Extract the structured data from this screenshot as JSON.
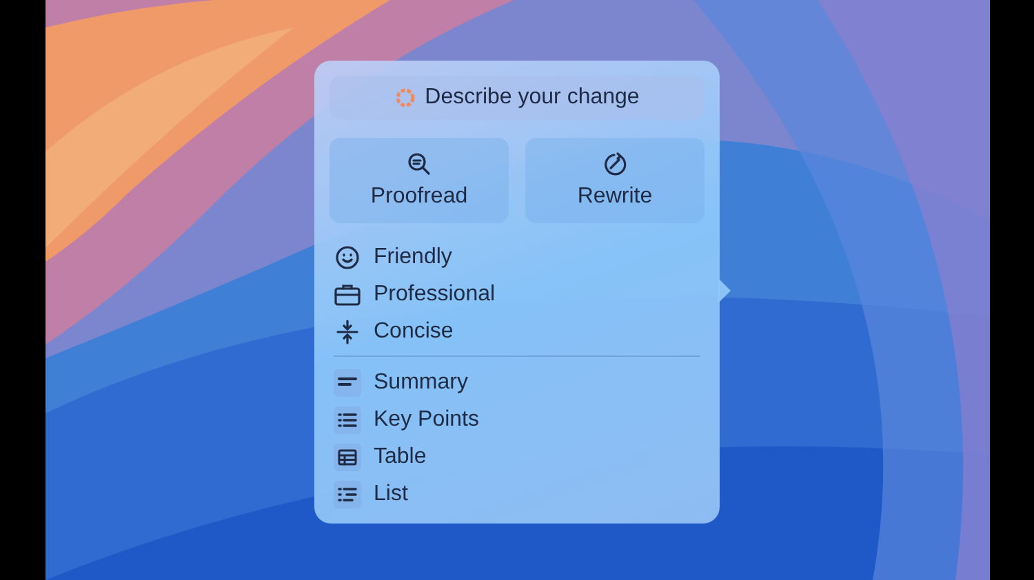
{
  "prompt": {
    "label": "Describe your change"
  },
  "actions": [
    {
      "label": "Proofread",
      "kind": "proofread"
    },
    {
      "label": "Rewrite",
      "kind": "rewrite"
    }
  ],
  "tones": [
    {
      "label": "Friendly",
      "kind": "smile"
    },
    {
      "label": "Professional",
      "kind": "briefcase"
    },
    {
      "label": "Concise",
      "kind": "compress"
    }
  ],
  "formats": [
    {
      "label": "Summary",
      "kind": "summary"
    },
    {
      "label": "Key Points",
      "kind": "bullets"
    },
    {
      "label": "Table",
      "kind": "table"
    },
    {
      "label": "List",
      "kind": "list"
    }
  ]
}
